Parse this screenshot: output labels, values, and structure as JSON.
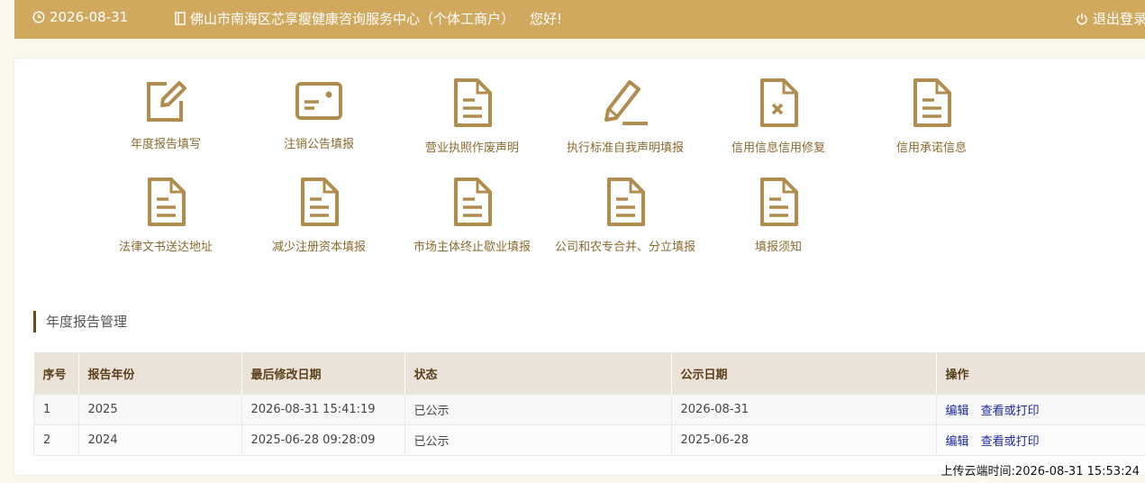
{
  "topbar": {
    "date": "2026-08-31",
    "org_name": "佛山市南海区芯享瘦健康咨询服务中心（个体工商户）",
    "greeting": "您好!",
    "logout_label": "退出登录"
  },
  "menu": [
    {
      "label": "年度报告填写",
      "icon": "edit-square-icon"
    },
    {
      "label": "注销公告填报",
      "icon": "id-card-icon"
    },
    {
      "label": "营业执照作废声明",
      "icon": "document-icon"
    },
    {
      "label": "执行标准自我声明填报",
      "icon": "pencil-icon"
    },
    {
      "label": "信用信息信用修复",
      "icon": "document-x-icon"
    },
    {
      "label": "信用承诺信息",
      "icon": "document-icon"
    },
    {
      "label": "法律文书送达地址",
      "icon": "document-icon"
    },
    {
      "label": "减少注册资本填报",
      "icon": "document-icon"
    },
    {
      "label": "市场主体终止歇业填报",
      "icon": "document-icon"
    },
    {
      "label": "公司和农专合并、分立填报",
      "icon": "document-icon"
    },
    {
      "label": "填报须知",
      "icon": "document-icon"
    }
  ],
  "section": {
    "title": "年度报告管理"
  },
  "table": {
    "headers": [
      "序号",
      "报告年份",
      "最后修改日期",
      "状态",
      "公示日期",
      "操作"
    ],
    "rows": [
      {
        "no": "1",
        "year": "2025",
        "modified": "2026-08-31 15:41:19",
        "status": "已公示",
        "pub_date": "2026-08-31",
        "edit": "编辑",
        "view": "查看或打印"
      },
      {
        "no": "2",
        "year": "2024",
        "modified": "2025-06-28 09:28:09",
        "status": "已公示",
        "pub_date": "2025-06-28",
        "edit": "编辑",
        "view": "查看或打印"
      }
    ]
  },
  "footer": {
    "upload_time": "上传云端时间:2026-08-31 15:53:24"
  },
  "colors": {
    "accent": "#d0a95f",
    "icon": "#b08d4f",
    "link": "#1c2a9e"
  }
}
